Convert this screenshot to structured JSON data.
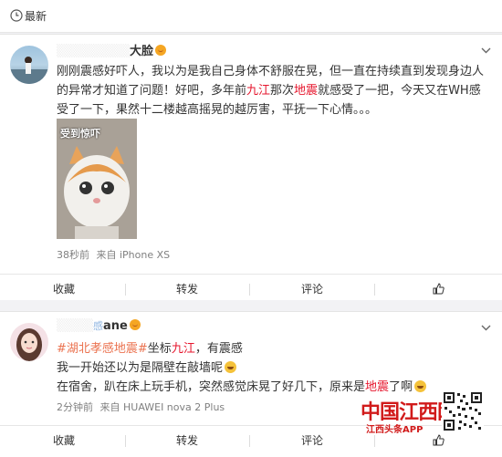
{
  "header": {
    "title": "最新"
  },
  "post1": {
    "username_suffix": "大脸",
    "text_a": "刚刚震感好吓人，我以为是我自己身体不舒服在晃，但一直在持续直到发现身边人的异常才知道了问题！好吧，多年前",
    "link_jiujiang": "九江",
    "text_b": "那次",
    "link_dizhen": "地震",
    "text_c": "就感受了一把，今天又在WH感受了一下，果然十二楼越高摇晃的越厉害，平抚一下心情。。。",
    "image_caption": "受到惊吓",
    "time": "38秒前",
    "source": "来自 iPhone XS"
  },
  "post2": {
    "username_prefix": "感",
    "username_suffix": "ane",
    "topic1": "#湖北孝感地震#",
    "topic_label": "坐标",
    "location": "九江",
    "line1_tail": "，有震感",
    "line2": "我一开始还以为是隔壁在敲墙呢",
    "line3_a": "在宿舍，趴在床上玩手机，突然感觉床晃了好几下，原来是",
    "line3_link": "地震",
    "line3_b": "了啊",
    "time": "2分钟前",
    "source": "来自 HUAWEI nova 2 Plus"
  },
  "actions": {
    "favorite": "收藏",
    "repost": "转发",
    "comment": "评论"
  },
  "watermark": {
    "logo_text": "中国江西网",
    "subtitle": "江西头条APP"
  },
  "colors": {
    "accent": "#eb7350",
    "link_red": "#e6162d",
    "watermark_red": "#d11a1a"
  }
}
